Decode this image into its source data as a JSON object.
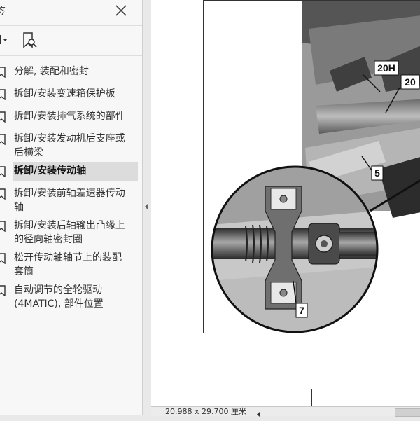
{
  "panel": {
    "title": "签",
    "bookmarks": [
      {
        "label": "分解, 装配和密封"
      },
      {
        "label": "拆卸/安装变速箱保护板"
      },
      {
        "label": "拆卸/安装排气系统的部件"
      },
      {
        "label": "拆卸/安装发动机后支座或\n后横梁"
      },
      {
        "label": "拆卸/安装传动轴",
        "selected": true
      },
      {
        "label": "拆卸/安装前轴差速器传动\n轴"
      },
      {
        "label": "拆卸/安装后轴输出凸缘上\n的径向轴密封圈"
      },
      {
        "label": "松开传动轴轴节上的装配\n套筒"
      },
      {
        "label": "自动调节的全轮驱动\n(4MATIC), 部件位置"
      }
    ]
  },
  "figure": {
    "callouts": [
      "20H",
      "20",
      "5",
      "7"
    ]
  },
  "status": {
    "page_size": "20.988 x 29.700 厘米"
  },
  "colors": {
    "panel_bg": "#f7f7f7",
    "selected_bg": "#dcdcdc",
    "doc_bg": "#ffffff"
  }
}
